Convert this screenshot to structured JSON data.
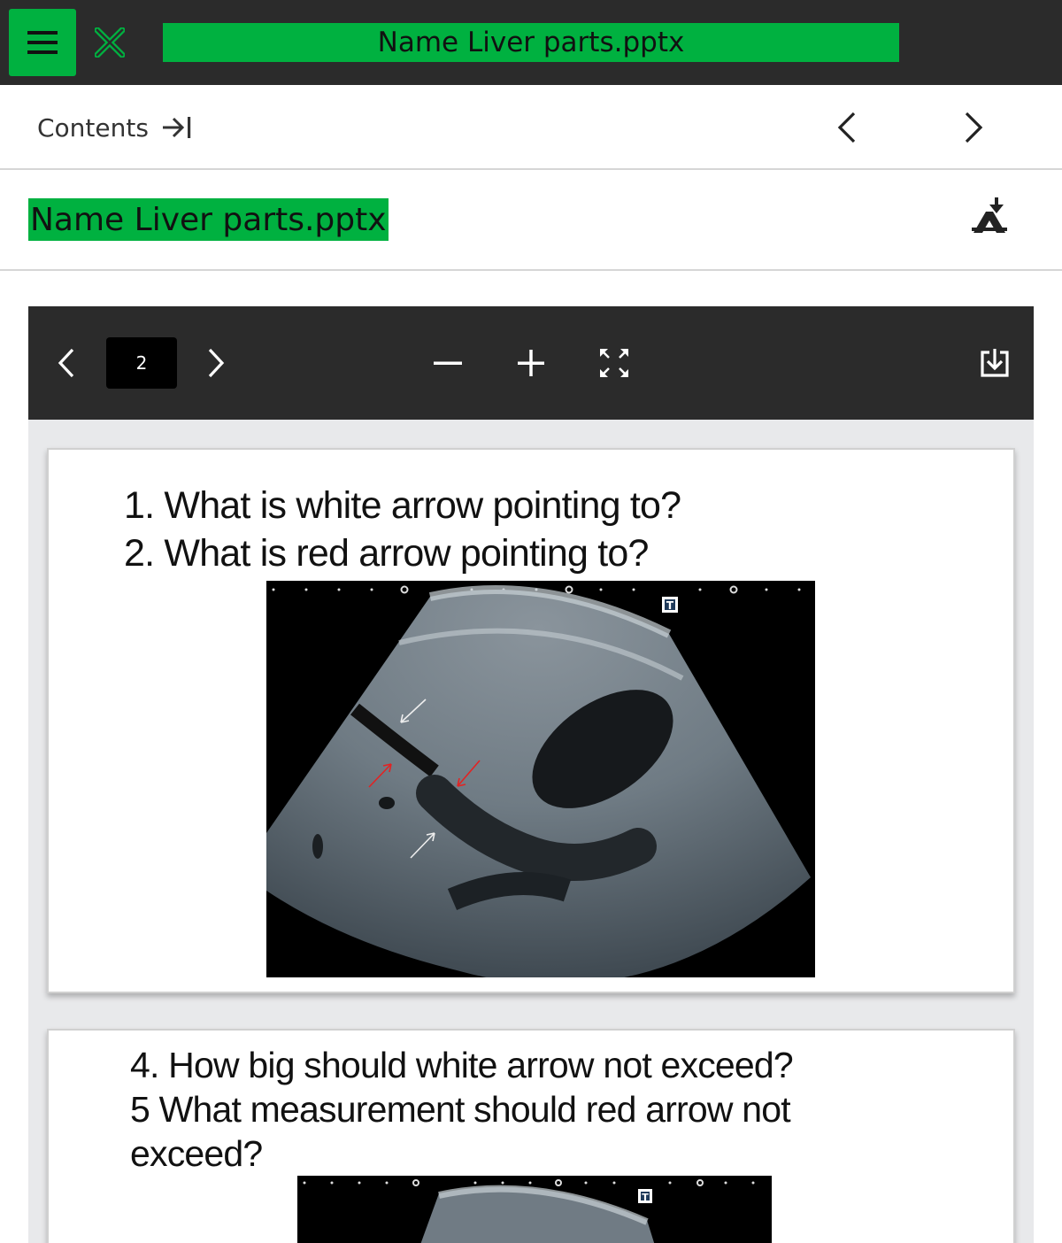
{
  "topbar": {
    "menu_icon": "hamburger-icon",
    "close_icon": "close-x-icon",
    "title": "Name Liver parts.pptx",
    "accent_color": "#00b140",
    "bg_color": "#2b2b2b"
  },
  "contents_row": {
    "contents_label": "Contents",
    "contents_icon": "expand-right-icon",
    "prev_icon": "chevron-left-icon",
    "next_icon": "chevron-right-icon"
  },
  "document": {
    "title": "Name Liver parts.pptx",
    "accessibility_icon": "accessibility-icon"
  },
  "viewer": {
    "page_number": "2",
    "zoom_out_icon": "minus-icon",
    "zoom_in_icon": "plus-icon",
    "fullscreen_icon": "fullscreen-icon",
    "download_icon": "download-icon",
    "slides": [
      {
        "lines": [
          "1. What is white arrow pointing to?",
          "2. What is red arrow pointing to?"
        ],
        "image": "ultrasound-liver-image",
        "image_marker": "T"
      },
      {
        "lines": [
          "4. How big should white arrow not exceed?",
          "5 What measurement should red arrow not",
          "exceed?"
        ],
        "image": "ultrasound-liver-image",
        "image_marker": "T"
      }
    ]
  }
}
